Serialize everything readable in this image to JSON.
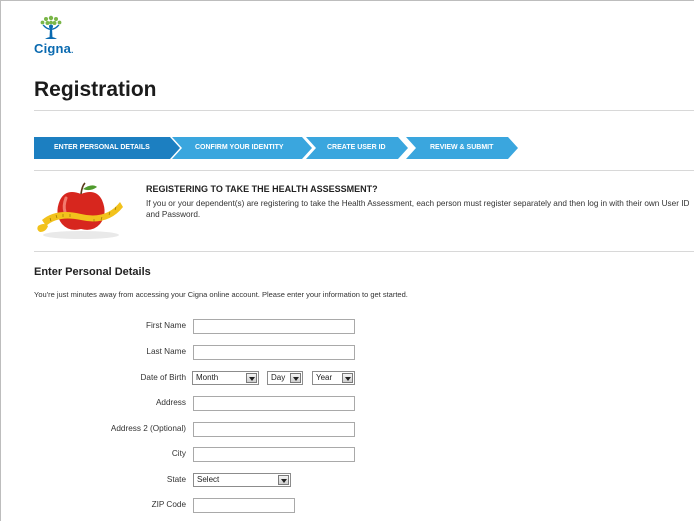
{
  "brand": {
    "logo_text": "Cigna",
    "logo_mark": "tree-of-life-icon",
    "primary_color": "#0a6ab0",
    "accent_color": "#7ab648"
  },
  "page": {
    "title": "Registration"
  },
  "steps": [
    {
      "label": "ENTER PERSONAL DETAILS",
      "state": "active"
    },
    {
      "label": "CONFIRM YOUR IDENTITY",
      "state": "inactive"
    },
    {
      "label": "CREATE USER ID",
      "state": "inactive"
    },
    {
      "label": "REVIEW & SUBMIT",
      "state": "inactive"
    }
  ],
  "step_colors": {
    "active": "#1c7fc1",
    "inactive": "#3aa6de"
  },
  "notice": {
    "image": "apple-with-measuring-tape",
    "heading": "REGISTERING TO TAKE THE HEALTH ASSESSMENT?",
    "body": "If you or your dependent(s) are registering to take the Health Assessment, each person must register separately and then log in with their own User ID and Password."
  },
  "section": {
    "title": "Enter Personal Details",
    "intro": "You're just minutes away from accessing your Cigna online account. Please enter your information to get started."
  },
  "form": {
    "first_name": {
      "label": "First Name",
      "value": ""
    },
    "last_name": {
      "label": "Last Name",
      "value": ""
    },
    "dob": {
      "label": "Date of Birth",
      "month": "Month",
      "day": "Day",
      "year": "Year"
    },
    "address": {
      "label": "Address",
      "value": ""
    },
    "address2": {
      "label": "Address 2 (Optional)",
      "value": ""
    },
    "city": {
      "label": "City",
      "value": ""
    },
    "state": {
      "label": "State",
      "value": "Select"
    },
    "zip": {
      "label": "ZIP Code",
      "value": ""
    }
  }
}
